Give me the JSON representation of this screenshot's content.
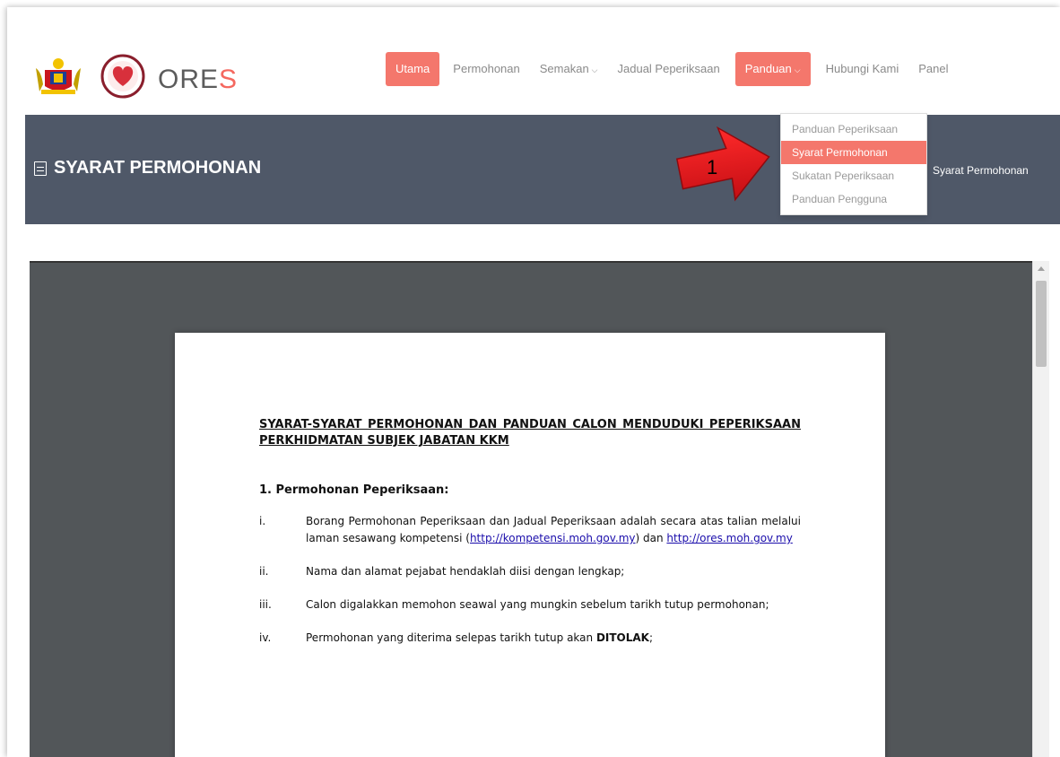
{
  "brand": {
    "name_main": "ORE",
    "name_accent": "S"
  },
  "nav": {
    "items": [
      {
        "label": "Utama",
        "active": true,
        "caret": false
      },
      {
        "label": "Permohonan",
        "active": false,
        "caret": false
      },
      {
        "label": "Semakan",
        "active": false,
        "caret": true
      },
      {
        "label": "Jadual Peperiksaan",
        "active": false,
        "caret": false
      },
      {
        "label": "Panduan",
        "active": true,
        "caret": true
      },
      {
        "label": "Hubungi Kami",
        "active": false,
        "caret": false
      },
      {
        "label": "Panel",
        "active": false,
        "caret": false
      }
    ]
  },
  "dropdown": {
    "items": [
      {
        "label": "Panduan Peperiksaan",
        "active": false
      },
      {
        "label": "Syarat Permohonan",
        "active": true
      },
      {
        "label": "Sukatan Peperiksaan",
        "active": false
      },
      {
        "label": "Panduan Pengguna",
        "active": false
      }
    ]
  },
  "band": {
    "title": "SYARAT PERMOHONAN",
    "breadcrumb": "Syarat Permohonan"
  },
  "annotation": {
    "number": "1",
    "color": "#e3171c"
  },
  "document": {
    "title": "SYARAT-SYARAT PERMOHONAN DAN PANDUAN CALON MENDUDUKI PEPERIKSAAN PERKHIDMATAN SUBJEK JABATAN KKM",
    "section": "1. Permohonan Peperiksaan:",
    "item1": {
      "num": "i.",
      "text_a": "Borang Permohonan Peperiksaan dan Jadual Peperiksaan adalah secara atas talian melalui laman sesawang kompetensi (",
      "link1": "http://kompetensi.moh.gov.my",
      "text_b": ") dan ",
      "link2": "http://ores.moh.gov.my"
    },
    "item2": {
      "num": "ii.",
      "text": "Nama dan alamat pejabat hendaklah diisi dengan lengkap;"
    },
    "item3": {
      "num": "iii.",
      "text": "Calon digalakkan memohon seawal yang mungkin sebelum tarikh tutup permohonan;"
    },
    "item4": {
      "num": "iv.",
      "text_a": "Permohonan yang diterima selepas tarikh tutup akan ",
      "bold": "DITOLAK",
      "text_b": ";"
    }
  },
  "colors": {
    "accent": "#f4776c",
    "band": "#4f5868",
    "viewer": "#525659"
  }
}
